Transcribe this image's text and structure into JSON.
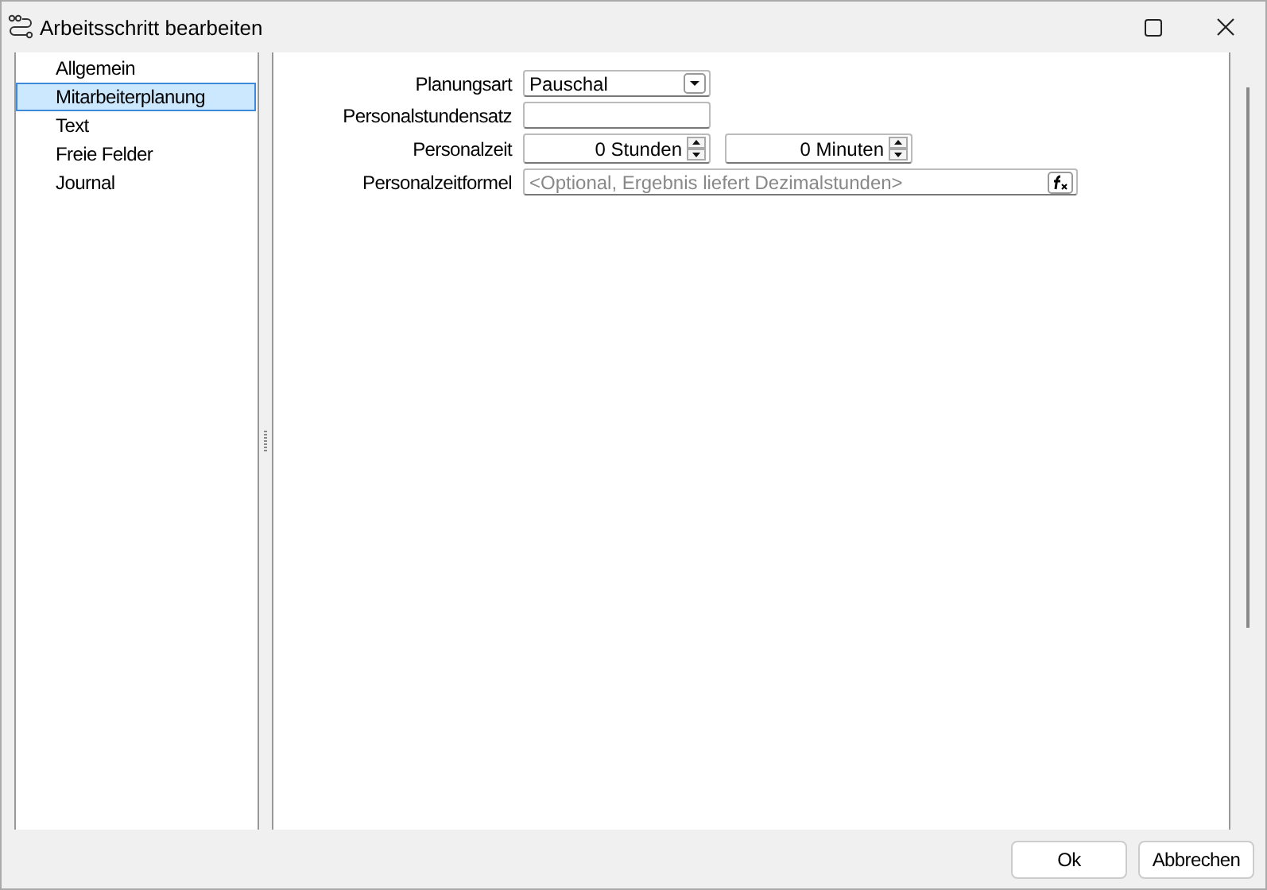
{
  "window": {
    "title": "Arbeitsschritt bearbeiten"
  },
  "nav": [
    {
      "label": "Allgemein",
      "selected": false
    },
    {
      "label": "Mitarbeiterplanung",
      "selected": true
    },
    {
      "label": "Text",
      "selected": false
    },
    {
      "label": "Freie Felder",
      "selected": false
    },
    {
      "label": "Journal",
      "selected": false
    }
  ],
  "fields": [
    {
      "kind": "select",
      "label": "Planungsart",
      "value": "Pauschal"
    },
    {
      "kind": "text",
      "label": "Personalstundensatz"
    },
    {
      "kind": "spins",
      "label": "Personalzeit",
      "values": [
        "0 Stunden",
        "0 Minuten"
      ]
    },
    {
      "kind": "formula",
      "label": "Personalzeitformel",
      "placeholder": "<Optional, Ergebnis liefert Dezimalstunden>"
    }
  ],
  "buttons": [
    "Ok",
    "Abbrechen"
  ]
}
